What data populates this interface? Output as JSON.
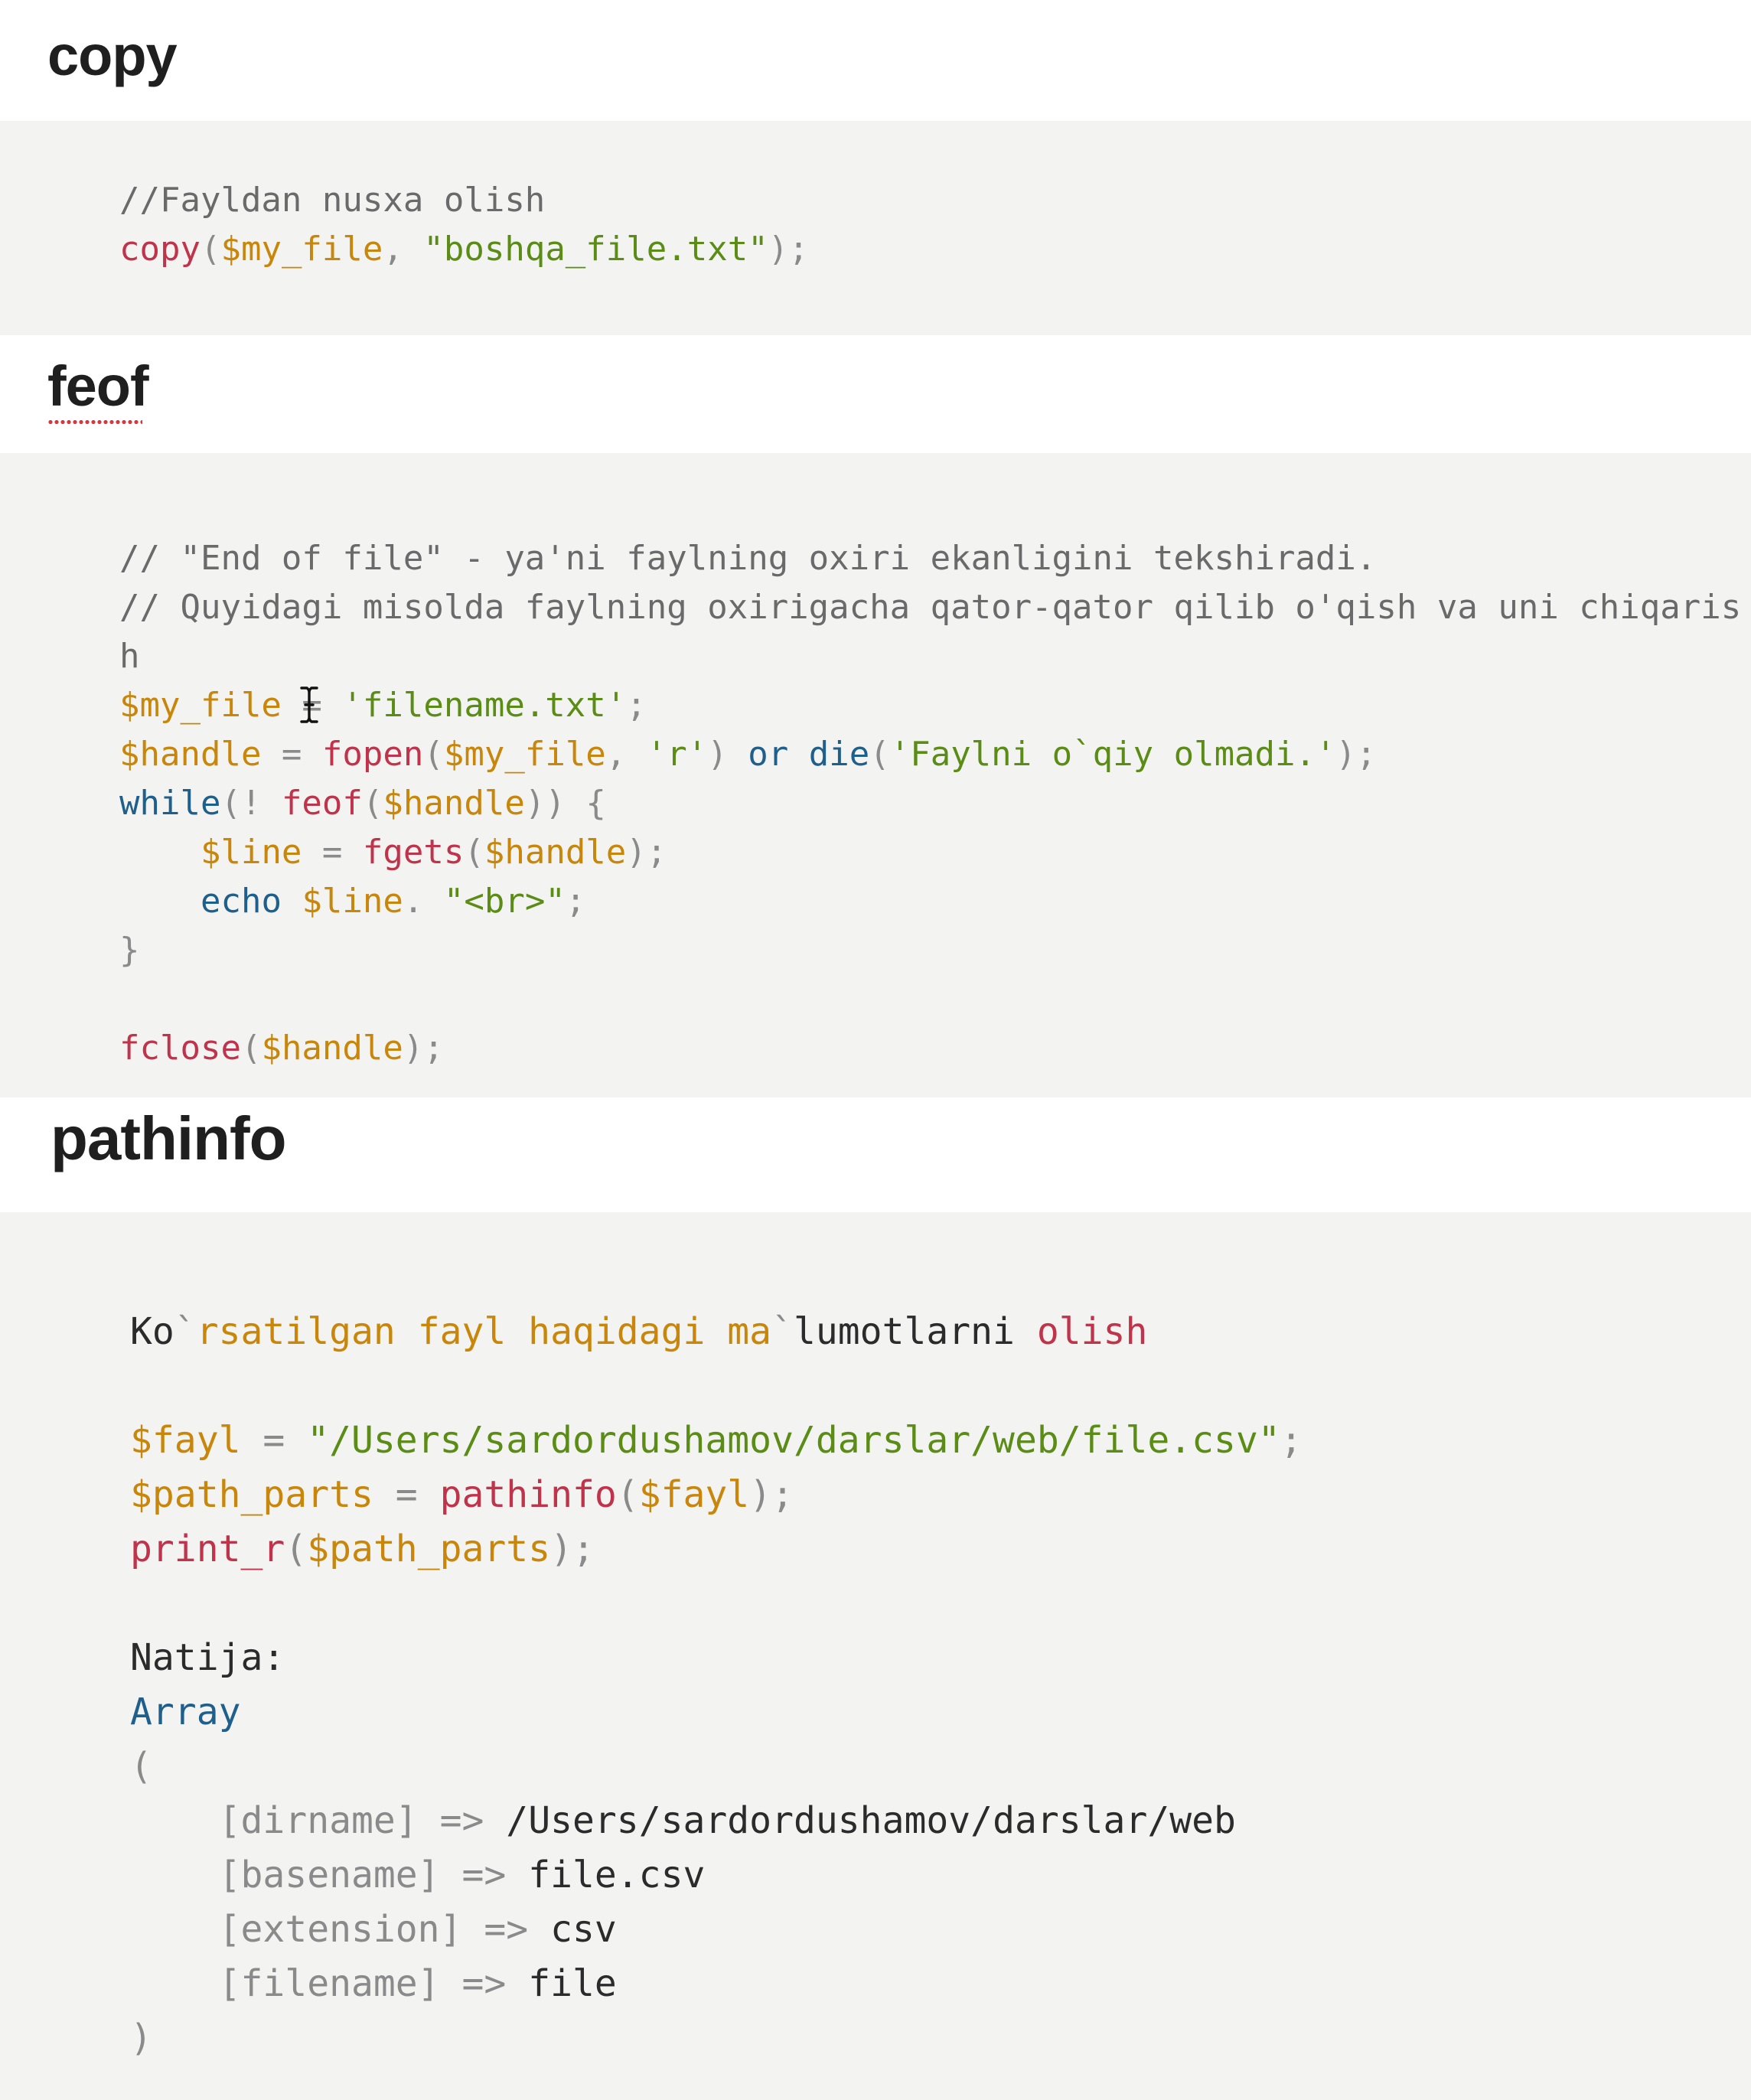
{
  "sections": {
    "copy": {
      "heading": "copy",
      "code": {
        "comment": "//Fayldan nusxa olish",
        "fn": "copy",
        "paren_open": "(",
        "var": "$my_file",
        "comma": ", ",
        "str": "\"boshqa_file.txt\"",
        "close": ");"
      }
    },
    "feof": {
      "heading": "feof",
      "comment1": "// \"End of file\" - ya'ni faylning oxiri ekanligini tekshiradi.",
      "comment2": "// Quyidagi misolda faylning oxirigacha qator-qator qilib o'qish va uni chiqaris",
      "comment2_wrap": "h",
      "line1": {
        "var": "$my_file",
        "op": " = ",
        "str": "'filename.txt'",
        "end": ";"
      },
      "line2": {
        "var": "$handle",
        "op": " = ",
        "fn": "fopen",
        "p1": "(",
        "arg1": "$my_file",
        "comma": ", ",
        "arg2": "'r'",
        "p2": ") ",
        "kw_or": "or",
        "sp": " ",
        "kw_die": "die",
        "p3": "(",
        "arg3": "'Faylni o`qiy olmadi.'",
        "end": ");"
      },
      "line3": {
        "kw": "while",
        "p1": "(! ",
        "fn": "feof",
        "p2": "(",
        "var": "$handle",
        "end": ")) {"
      },
      "line4": {
        "indent": "    ",
        "var": "$line",
        "op": " = ",
        "fn": "fgets",
        "p1": "(",
        "arg": "$handle",
        "end": ");"
      },
      "line5": {
        "indent": "    ",
        "kw": "echo",
        "sp": " ",
        "var": "$line",
        "dot": ". ",
        "str": "\"<br>\"",
        "end": ";"
      },
      "line6": "}",
      "line8": {
        "fn": "fclose",
        "p1": "(",
        "var": "$handle",
        "end": ");"
      }
    },
    "pathinfo": {
      "heading": "pathinfo",
      "desc": {
        "a": "Ko",
        "b": "`",
        "c": "rsatilgan fayl haqidagi ma",
        "d": "`",
        "e": "lumotlarni",
        "f": " ",
        "g": "olish"
      },
      "line1": {
        "var": "$fayl",
        "op": " = ",
        "str": "\"/Users/sardordushamov/darslar/web/file.csv\"",
        "end": ";"
      },
      "line2": {
        "var": "$path_parts",
        "op": " = ",
        "fn": "pathinfo",
        "p1": "(",
        "arg": "$fayl",
        "end": ");"
      },
      "line3": {
        "fn": "print_r",
        "p1": "(",
        "arg": "$path_parts",
        "end": ");"
      },
      "result_label": "Natija:",
      "array_kw": "Array",
      "open_paren": "(",
      "entries": [
        {
          "key": "[dirname]",
          "arrow": "=>",
          "value": "/Users/sardordushamov/darslar/web"
        },
        {
          "key": "[basename]",
          "arrow": "=>",
          "value": "file.csv"
        },
        {
          "key": "[extension]",
          "arrow": "=>",
          "value": "csv"
        },
        {
          "key": "[filename]",
          "arrow": "=>",
          "value": "file"
        }
      ],
      "close_paren": ")"
    }
  },
  "colors": {
    "page_background": "#ffffff",
    "code_background": "#f3f3f2",
    "heading_text": "#1f1f1f",
    "comment": "#6a6a6a",
    "function": "#c0344b",
    "variable": "#c8860a",
    "string": "#5b8c16",
    "keyword": "#1f5f8b",
    "spellcheck_underline": "#d9363e"
  },
  "icons": {
    "text_cursor": "i-beam-cursor-icon"
  }
}
